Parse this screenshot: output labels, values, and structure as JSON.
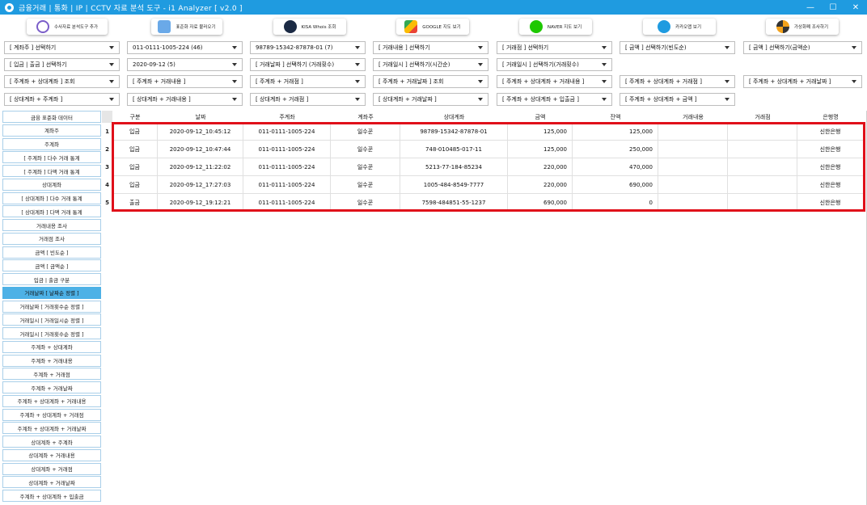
{
  "window": {
    "title": "금융거래 | 통화 | IP | CCTV  자료 분석 도구 - i1 Analyzer  [ v2.0 ]",
    "minimize_label": "—",
    "maximize_label": "☐",
    "close_label": "✕",
    "title_color": "#1f9be0"
  },
  "toolbar": {
    "buttons": [
      {
        "label": "수사자료 분석도구 추가",
        "icon": "i1-logo-icon"
      },
      {
        "label": "표준화 자료 불러오기",
        "icon": "document-icon"
      },
      {
        "label": "KISA Whois 조회",
        "icon": "kisa-logo-icon"
      },
      {
        "label": "GOOGLE 지도 보기",
        "icon": "google-maps-icon"
      },
      {
        "label": "NAVER 지도 보기",
        "icon": "naver-map-icon"
      },
      {
        "label": "카카오맵 보기",
        "icon": "kakaomap-icon"
      },
      {
        "label": "가상화폐 조사하기",
        "icon": "crypto-icon"
      }
    ]
  },
  "filters": {
    "row1": [
      "[ 계좌주 ] 선택하기",
      "011-0111-1005-224 (46)",
      "98789-15342-87878-01 (7)",
      "[ 거래내용 ] 선택하기",
      "[ 거래점 ] 선택하기",
      "[ 금액 ] 선택하기(빈도순)",
      "[ 금액 ] 선택하기(금액순)"
    ],
    "row2": [
      "[ 입금 | 출금 ] 선택하기",
      "2020-09-12 (5)",
      "[ 거래날짜 ] 선택하기 (거래횟수)",
      "[ 거래일시 ] 선택하기(시간순)",
      "[ 거래일시 ] 선택하기(거래횟수)"
    ],
    "row3": [
      "[ 주계좌 + 상대계좌 ] 조회",
      "[ 주계좌 + 거래내용 ]",
      "[ 주계좌 + 거래점 ]",
      "[ 주계좌 + 거래날짜 ] 조회",
      "[ 주계좌 + 상대계좌 + 거래내용 ]",
      "[ 주계좌 + 상대계좌 + 거래점 ]",
      "[ 주계좌 + 상대계좌 + 거래날짜 ]"
    ],
    "row4": [
      "[ 상대계좌 + 주계좌 ]",
      "[ 상대계좌 + 거래내용 ]",
      "[ 상대계좌 + 거래점 ]",
      "[ 상대계좌 + 거래날짜 ]",
      "[ 주계좌 + 상대계좌 + 입출금 ]",
      "[ 주계좌 + 상대계좌 + 금액 ]"
    ]
  },
  "sidebar": {
    "items": [
      {
        "label": "금융 표준화 데이터",
        "active": false
      },
      {
        "label": "계좌주",
        "active": false
      },
      {
        "label": "주계좌",
        "active": false
      },
      {
        "label": "[ 주계좌 ] 다수 거래 통계",
        "active": false
      },
      {
        "label": "[ 주계좌 ] 다액 거래 통계",
        "active": false
      },
      {
        "label": "상대계좌",
        "active": false
      },
      {
        "label": "[ 상대계좌 ] 다수 거래 통계",
        "active": false
      },
      {
        "label": "[ 상대계좌 ] 다액 거래 통계",
        "active": false
      },
      {
        "label": "거래내용 조사",
        "active": false
      },
      {
        "label": "거래점 조사",
        "active": false
      },
      {
        "label": "금액 [ 빈도순 ]",
        "active": false
      },
      {
        "label": "금액 [ 금액순 ]",
        "active": false
      },
      {
        "label": "입금 | 출금 구분",
        "active": false
      },
      {
        "label": "거래날짜 [ 날짜순 정렬 ]",
        "active": true
      },
      {
        "label": "거래날짜 [ 거래횟수순 정렬 ]",
        "active": false
      },
      {
        "label": "거래일시 [ 거래일시순 정렬 ]",
        "active": false
      },
      {
        "label": "거래일시 [ 거래횟수순 정렬 ]",
        "active": false
      },
      {
        "label": "주계좌 + 상대계좌",
        "active": false
      },
      {
        "label": "주계좌 + 거래내용",
        "active": false
      },
      {
        "label": "주계좌 + 거래점",
        "active": false
      },
      {
        "label": "주계좌 + 거래날짜",
        "active": false
      },
      {
        "label": "주계좌 + 상대계좌 + 거래내용",
        "active": false
      },
      {
        "label": "주계좌 + 상대계좌 + 거래점",
        "active": false
      },
      {
        "label": "주계좌 + 상대계좌 + 거래날짜",
        "active": false
      },
      {
        "label": "상대계좌 + 주계좌",
        "active": false
      },
      {
        "label": "상대계좌 + 거래내용",
        "active": false
      },
      {
        "label": "상대계좌 + 거래점",
        "active": false
      },
      {
        "label": "상대계좌 + 거래날짜",
        "active": false
      },
      {
        "label": "주계좌 + 상대계좌 + 입출금",
        "active": false
      }
    ],
    "active_color": "#4db1e6"
  },
  "table": {
    "columns": [
      "구분",
      "날짜",
      "주계좌",
      "계좌주",
      "상대계좌",
      "금액",
      "잔액",
      "거래내용",
      "거래점",
      "은행명"
    ],
    "rows": [
      {
        "num": "1",
        "cells": [
          "입금",
          "2020-09-12_10:45:12",
          "011-0111-1005-224",
          "일수꾼",
          "98789-15342-87878-01",
          "125,000",
          "125,000",
          "",
          "",
          "신한은행"
        ]
      },
      {
        "num": "2",
        "cells": [
          "입금",
          "2020-09-12_10:47:44",
          "011-0111-1005-224",
          "일수꾼",
          "748-010485-017-11",
          "125,000",
          "250,000",
          "",
          "",
          "신한은행"
        ]
      },
      {
        "num": "3",
        "cells": [
          "입금",
          "2020-09-12_11:22:02",
          "011-0111-1005-224",
          "일수꾼",
          "5213-77-184-85234",
          "220,000",
          "470,000",
          "",
          "",
          "신한은행"
        ]
      },
      {
        "num": "4",
        "cells": [
          "입금",
          "2020-09-12_17:27:03",
          "011-0111-1005-224",
          "일수꾼",
          "1005-484-8549-7777",
          "220,000",
          "690,000",
          "",
          "",
          "신한은행"
        ]
      },
      {
        "num": "5",
        "cells": [
          "출금",
          "2020-09-12_19:12:21",
          "011-0111-1005-224",
          "일수꾼",
          "7598-484851-55-1237",
          "690,000",
          "0",
          "",
          "",
          "신한은행"
        ]
      }
    ],
    "highlight_color": "#e0101a"
  }
}
